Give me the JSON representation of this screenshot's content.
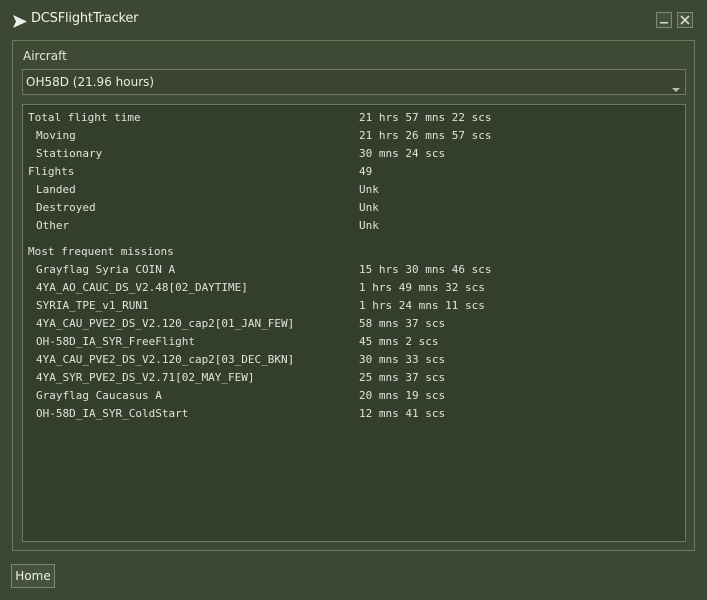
{
  "window": {
    "title": "DCSFlightTracker",
    "icons": {
      "app": "paper-plane-icon",
      "minimize": "minimize-icon",
      "close": "close-icon"
    }
  },
  "aircraft": {
    "label": "Aircraft",
    "selected": "OH58D (21.96 hours)"
  },
  "stats": {
    "total_flight_time": {
      "label": "Total flight time",
      "value": "21 hrs 57 mns 22 scs"
    },
    "moving": {
      "label": "Moving",
      "value": "21 hrs 26 mns 57 scs"
    },
    "stationary": {
      "label": "Stationary",
      "value": "30 mns 24 scs"
    },
    "flights": {
      "label": "Flights",
      "value": "49"
    },
    "landed": {
      "label": "Landed",
      "value": "Unk"
    },
    "destroyed": {
      "label": "Destroyed",
      "value": "Unk"
    },
    "other": {
      "label": "Other",
      "value": "Unk"
    }
  },
  "missions": {
    "header": "Most frequent missions",
    "items": [
      {
        "name": "Grayflag Syria COIN A",
        "time": "15 hrs 30 mns 46 scs"
      },
      {
        "name": "4YA_AO_CAUC_DS_V2.48[02_DAYTIME]",
        "time": "1 hrs 49 mns 32 scs"
      },
      {
        "name": "SYRIA_TPE_v1_RUN1",
        "time": "1 hrs 24 mns 11 scs"
      },
      {
        "name": "4YA_CAU_PVE2_DS_V2.120_cap2[01_JAN_FEW]",
        "time": "58 mns 37 scs"
      },
      {
        "name": "OH-58D_IA_SYR_FreeFlight",
        "time": "45 mns 2 scs"
      },
      {
        "name": "4YA_CAU_PVE2_DS_V2.120_cap2[03_DEC_BKN]",
        "time": "30 mns 33 scs"
      },
      {
        "name": "4YA_SYR_PVE2_DS_V2.71[02_MAY_FEW]",
        "time": "25 mns 37 scs"
      },
      {
        "name": "Grayflag Caucasus A",
        "time": "20 mns 19 scs"
      },
      {
        "name": "OH-58D_IA_SYR_ColdStart",
        "time": "12 mns 41 scs"
      }
    ]
  },
  "footer": {
    "home_label": "Home"
  }
}
